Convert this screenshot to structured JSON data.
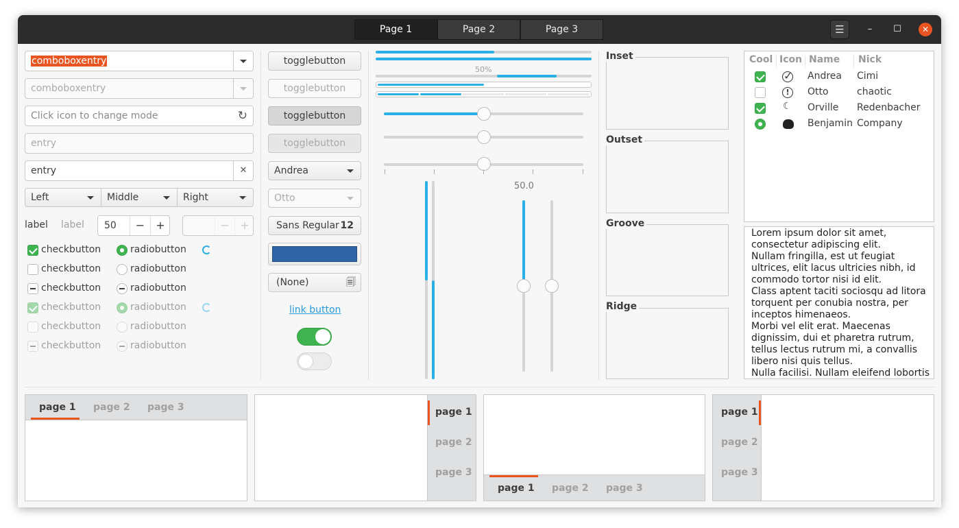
{
  "header": {
    "tabs": [
      {
        "label": "Page 1"
      },
      {
        "label": "Page 2"
      },
      {
        "label": "Page 3"
      }
    ],
    "menu_icon": "hamburger-menu-icon",
    "controls": {
      "minimize": "–",
      "maximize": "☐",
      "close": "✕"
    }
  },
  "colors": {
    "accent": "#e95420",
    "selection_blue": "#2ab0e6",
    "check_green": "#3eb34f",
    "link": "#2a9ad8"
  },
  "col1": {
    "combo1": "comboboxentry",
    "combo2": "comboboxentry",
    "icon_entry_placeholder": "Click icon to change mode",
    "entry_disabled": "entry",
    "entry_clear": "entry",
    "segmented": [
      {
        "label": "Left"
      },
      {
        "label": "Middle"
      },
      {
        "label": "Right"
      }
    ],
    "label1": "label",
    "label2": "label",
    "spin_value": "50",
    "spin_minus": "−",
    "spin_plus": "+",
    "check_label": "checkbutton",
    "radio_label": "radiobutton"
  },
  "col2": {
    "toggle_labels": [
      "togglebutton",
      "togglebutton",
      "togglebutton",
      "togglebutton"
    ],
    "combo_andrea": "Andrea",
    "combo_otto": "Otto",
    "font_name": "Sans Regular",
    "font_size": "12",
    "color_value": "#2f65a5",
    "file_chooser": "(None)",
    "link_label": "link button",
    "switch1_on": true,
    "switch2_on": false
  },
  "col3": {
    "progress_label": "50%",
    "scale_value": "50.0",
    "progress_values": [
      0.55,
      1.0,
      0.65,
      0.5
    ],
    "hscale_levels": [
      0.5,
      0.5,
      0.5
    ],
    "vscale_levels": [
      0.5,
      0.5
    ]
  },
  "frames": [
    {
      "title": "Inset"
    },
    {
      "title": "Outset"
    },
    {
      "title": "Groove"
    },
    {
      "title": "Ridge"
    }
  ],
  "treeview": {
    "headers": [
      "Cool",
      "Icon",
      "Name",
      "Nick"
    ],
    "rows": [
      {
        "name": "Andrea",
        "nick": "Cimi",
        "icon": "checkmark-circle-icon"
      },
      {
        "name": "Otto",
        "nick": "chaotic",
        "icon": "exclamation-circle-icon"
      },
      {
        "name": "Orville",
        "nick": "Redenbacher",
        "icon": "moon-face-icon"
      },
      {
        "name": "Benjamin",
        "nick": "Company",
        "icon": "bowler-face-icon"
      }
    ]
  },
  "textview": {
    "lines": [
      "Lorem ipsum dolor sit amet,",
      "consectetur adipiscing elit.",
      "Nullam fringilla, est ut feugiat",
      "ultrices, elit lacus ultricies nibh, id",
      "commodo tortor nisi id elit.",
      "Class aptent taciti sociosqu ad litora",
      "torquent per conubia nostra, per",
      "inceptos himenaeos.",
      "Morbi vel elit erat. Maecenas",
      "dignissim, dui et pharetra rutrum,",
      "tellus lectus rutrum mi, a convallis",
      "libero nisi quis tellus.",
      "Nulla facilisi. Nullam eleifend lobortis"
    ]
  },
  "notebooks": {
    "tab_labels": [
      "page 1",
      "page 2",
      "page 3"
    ]
  }
}
